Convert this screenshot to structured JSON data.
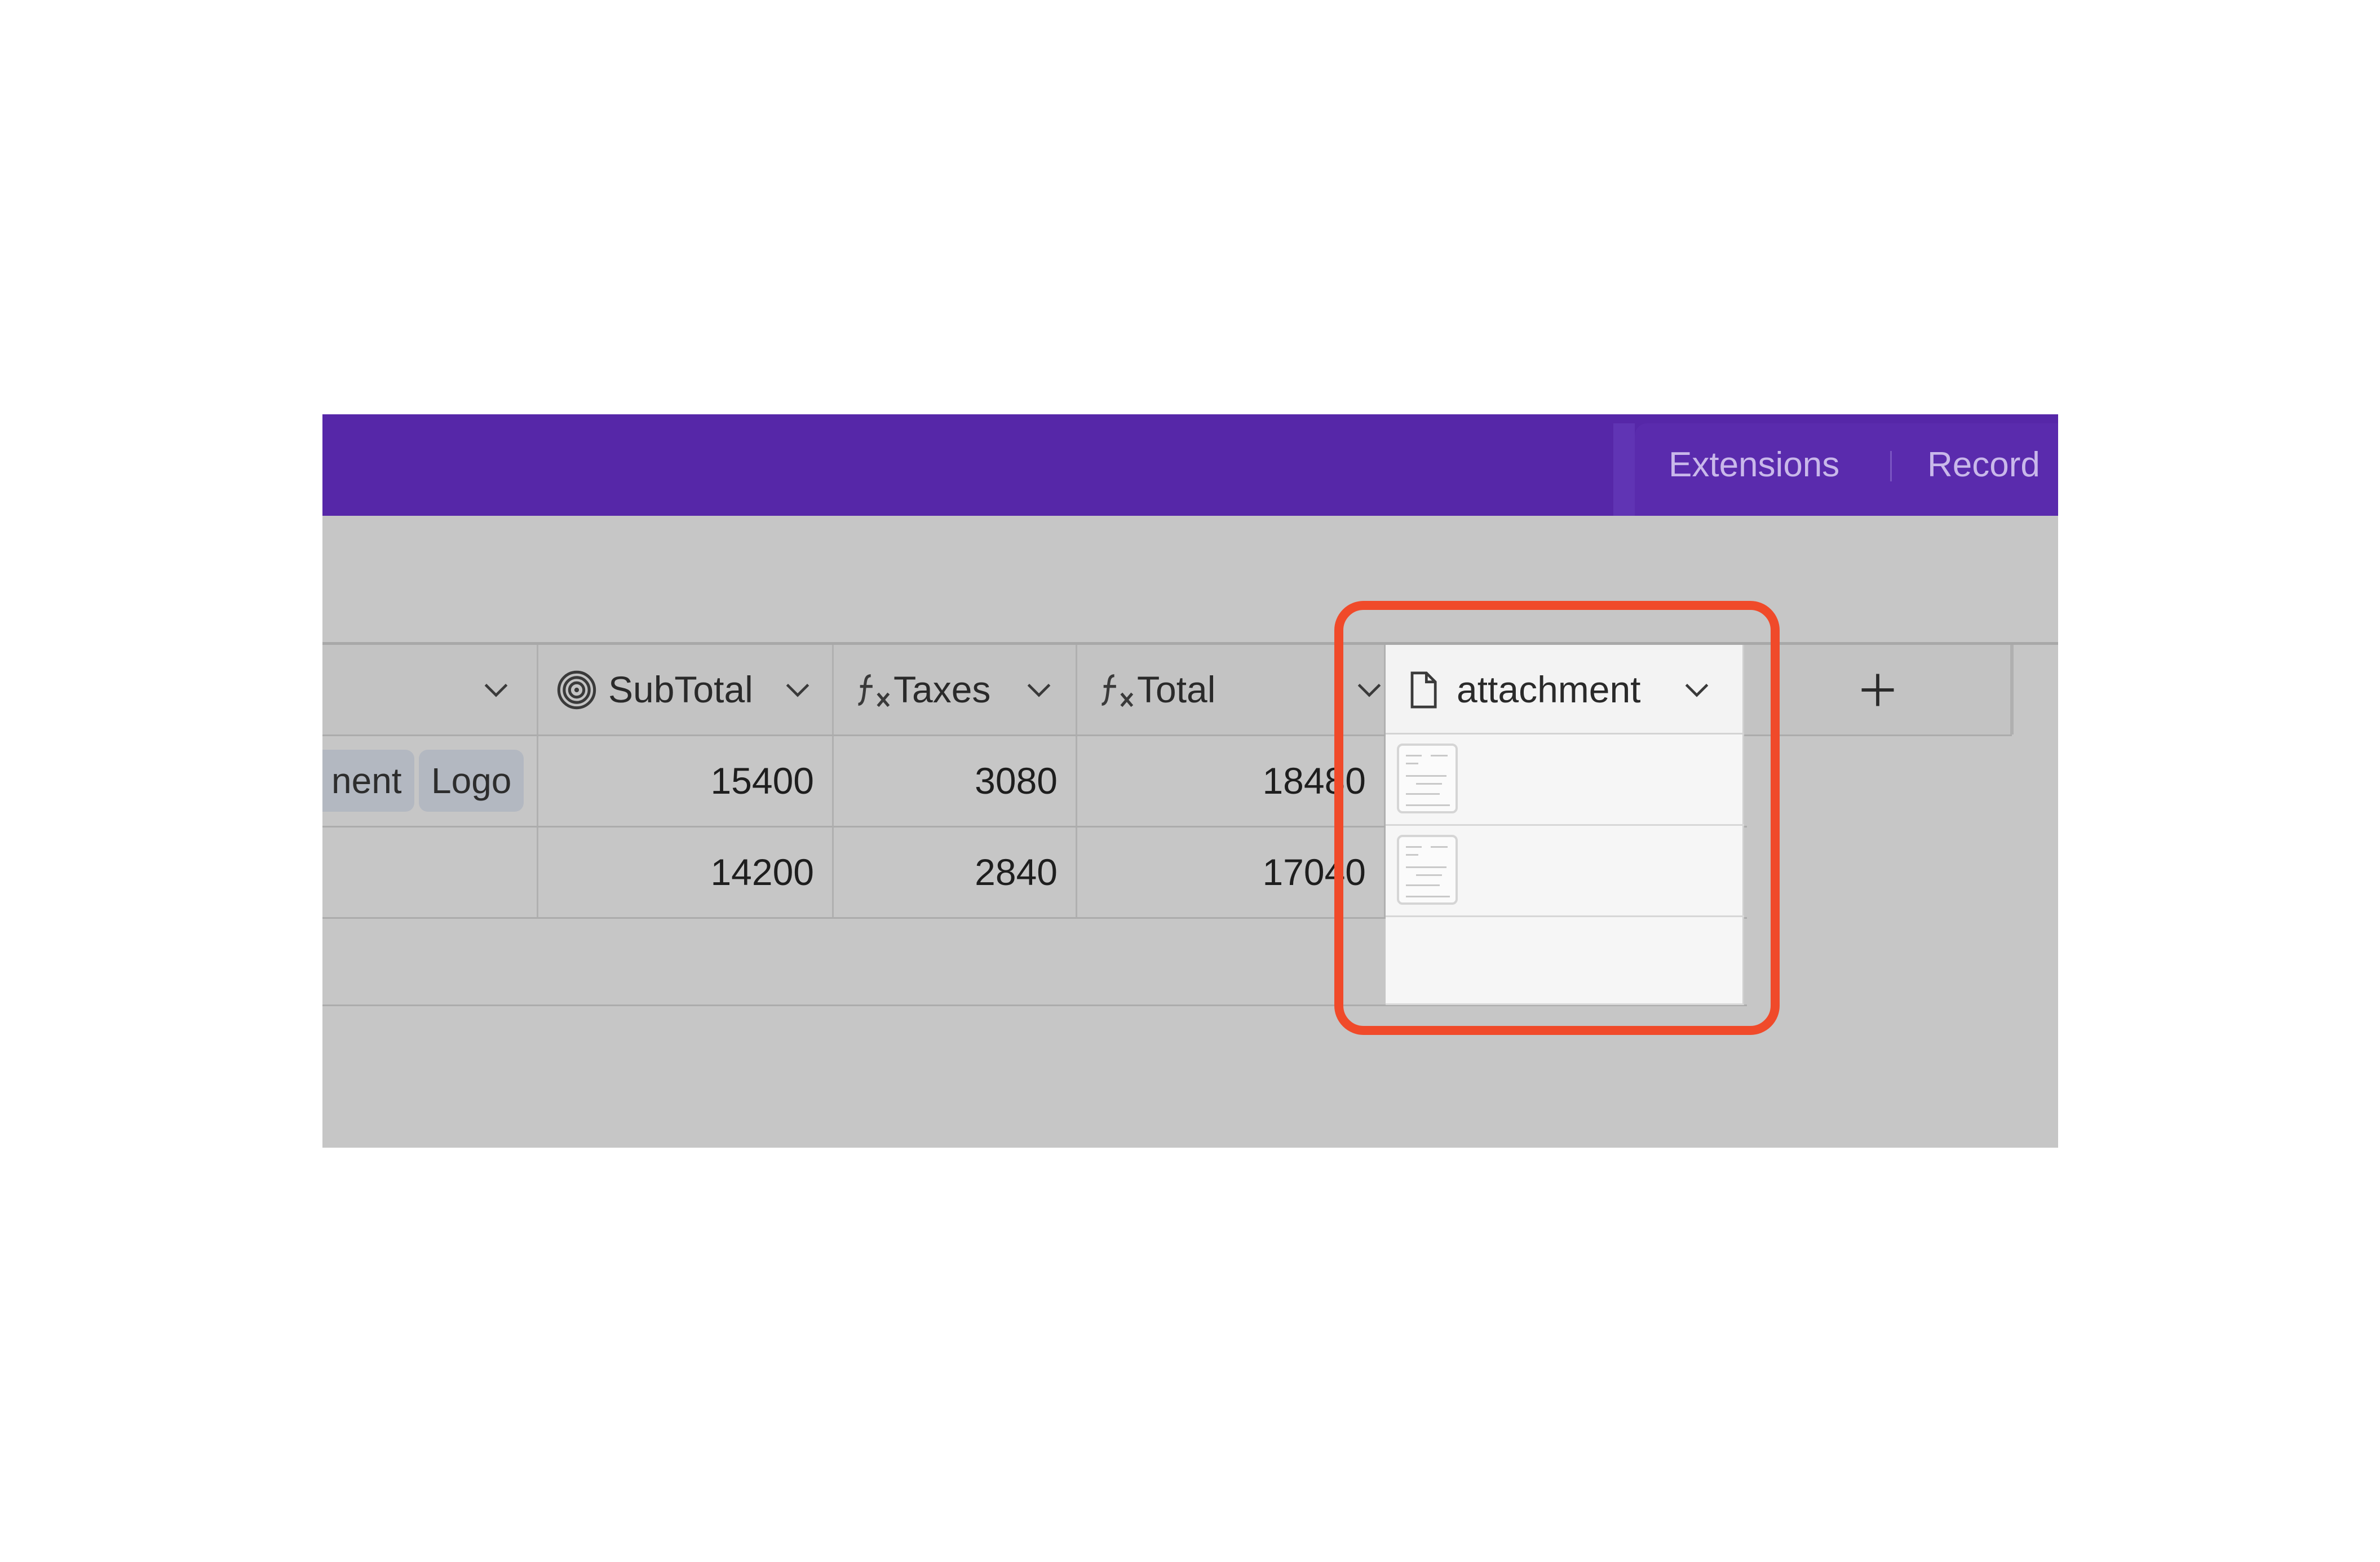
{
  "topbar": {
    "extensions_label": "Extensions",
    "record_label": "Record",
    "background_color": "#5627a8"
  },
  "table": {
    "columns": [
      {
        "label": "",
        "icon": "none"
      },
      {
        "label": "SubTotal",
        "icon": "rollup-spiral-icon"
      },
      {
        "label": "Taxes",
        "icon": "formula-icon"
      },
      {
        "label": "Total",
        "icon": "formula-icon"
      },
      {
        "label": "attachment",
        "icon": "file-icon"
      }
    ],
    "add_column_label": "+",
    "rows": [
      {
        "tags": [
          "nent",
          "Logo"
        ],
        "subtotal": "15400",
        "taxes": "3080",
        "total": "18480"
      },
      {
        "tags": [],
        "subtotal": "14200",
        "taxes": "2840",
        "total": "17040"
      }
    ]
  },
  "highlight": {
    "color": "#f04a2a",
    "target": "attachment column"
  }
}
